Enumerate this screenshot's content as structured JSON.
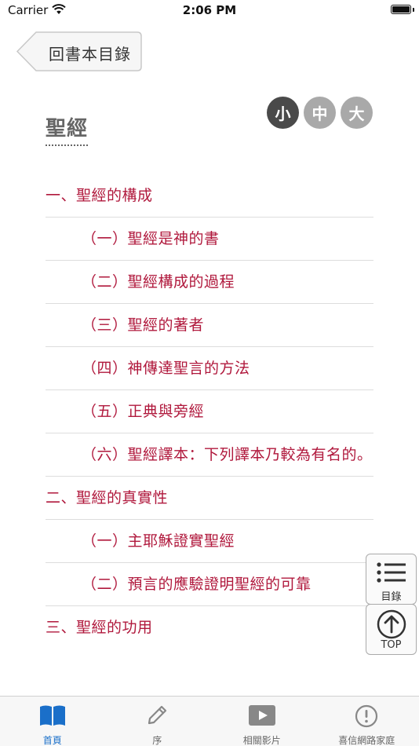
{
  "status_bar": {
    "carrier": "Carrier",
    "time": "2:06 PM"
  },
  "nav": {
    "back_label": "回書本目錄"
  },
  "page_title": "聖經",
  "font_sizes": [
    {
      "label": "小",
      "active": true
    },
    {
      "label": "中",
      "active": false
    },
    {
      "label": "大",
      "active": false
    }
  ],
  "toc": [
    {
      "label": "一、聖經的構成",
      "level": 1
    },
    {
      "label": "（一）聖經是神的書",
      "level": 2
    },
    {
      "label": "（二）聖經構成的過程",
      "level": 2
    },
    {
      "label": "（三）聖經的著者",
      "level": 2
    },
    {
      "label": "（四）神傳達聖言的方法",
      "level": 2
    },
    {
      "label": "（五）正典與旁經",
      "level": 2
    },
    {
      "label": "（六）聖經譯本：下列譯本乃較為有名的。",
      "level": 2
    },
    {
      "label": "二、聖經的真實性",
      "level": 1
    },
    {
      "label": "（一）主耶穌證實聖經",
      "level": 2
    },
    {
      "label": "（二）預言的應驗證明聖經的可靠",
      "level": 2
    },
    {
      "label": "三、聖經的功用",
      "level": 1
    }
  ],
  "floating": {
    "toc_label": "目錄",
    "top_label": "TOP"
  },
  "tabs": [
    {
      "label": "首頁",
      "icon": "book-open-icon",
      "active": true
    },
    {
      "label": "序",
      "icon": "pencil-icon",
      "active": false
    },
    {
      "label": "相關影片",
      "icon": "video-play-icon",
      "active": false
    },
    {
      "label": "喜信網路家庭",
      "icon": "exclamation-circle-icon",
      "active": false
    }
  ],
  "colors": {
    "link": "#b0183c",
    "tab_active": "#1a6fc9",
    "size_active": "#4a4a4a",
    "size_inactive": "#a9a9a9"
  }
}
